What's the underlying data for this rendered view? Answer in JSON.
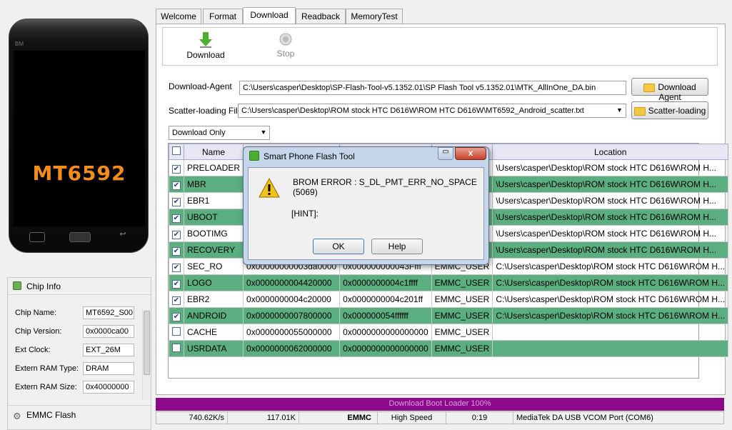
{
  "phone": {
    "brand": "BM",
    "chip": "MT6592"
  },
  "chip_info": {
    "header": "Chip Info",
    "fields": [
      {
        "label": "Chip Name:",
        "value": "MT6592_S00"
      },
      {
        "label": "Chip Version:",
        "value": "0x0000ca00"
      },
      {
        "label": "Ext Clock:",
        "value": "EXT_26M"
      },
      {
        "label": "Extern RAM Type:",
        "value": "DRAM"
      },
      {
        "label": "Extern RAM Size:",
        "value": "0x40000000"
      }
    ],
    "footer": "EMMC Flash"
  },
  "tabs": [
    "Welcome",
    "Format",
    "Download",
    "Readback",
    "MemoryTest"
  ],
  "toolbar": {
    "download": "Download",
    "stop": "Stop"
  },
  "agent": {
    "label": "Download-Agent",
    "value": "C:\\Users\\casper\\Desktop\\SP-Flash-Tool-v5.1352.01\\SP Flash Tool v5.1352.01\\MTK_AllInOne_DA.bin",
    "button": "Download Agent"
  },
  "scatter": {
    "label": "Scatter-loading File",
    "value": "C:\\Users\\casper\\Desktop\\ROM stock HTC D616W\\ROM HTC D616W\\MT6592_Android_scatter.txt",
    "button": "Scatter-loading"
  },
  "mode": "Download Only",
  "table": {
    "headers": [
      "Name",
      "Location"
    ],
    "rows": [
      {
        "name": "PRELOADER",
        "begin": "",
        "end": "",
        "region": "",
        "location": "\\Users\\casper\\Desktop\\ROM stock HTC D616W\\ROM H...",
        "checked": true
      },
      {
        "name": "MBR",
        "begin": "",
        "end": "",
        "region": "",
        "location": "\\Users\\casper\\Desktop\\ROM stock HTC D616W\\ROM H...",
        "checked": true
      },
      {
        "name": "EBR1",
        "begin": "",
        "end": "",
        "region": "",
        "location": "\\Users\\casper\\Desktop\\ROM stock HTC D616W\\ROM H...",
        "checked": true
      },
      {
        "name": "UBOOT",
        "begin": "",
        "end": "",
        "region": "",
        "location": "\\Users\\casper\\Desktop\\ROM stock HTC D616W\\ROM H...",
        "checked": true
      },
      {
        "name": "BOOTIMG",
        "begin": "",
        "end": "",
        "region": "",
        "location": "\\Users\\casper\\Desktop\\ROM stock HTC D616W\\ROM H...",
        "checked": true
      },
      {
        "name": "RECOVERY",
        "begin": "",
        "end": "",
        "region": "",
        "location": "\\Users\\casper\\Desktop\\ROM stock HTC D616W\\ROM H...",
        "checked": true
      },
      {
        "name": "SEC_RO",
        "begin": "0x00000000003da0000",
        "end": "0x000000000043Ffff",
        "region": "EMMC_USER",
        "location": "C:\\Users\\casper\\Desktop\\ROM stock HTC D616W\\ROM H...",
        "checked": true
      },
      {
        "name": "LOGO",
        "begin": "0x0000000004420000",
        "end": "0x0000000004c1ffff",
        "region": "EMMC_USER",
        "location": "C:\\Users\\casper\\Desktop\\ROM stock HTC D616W\\ROM H...",
        "checked": true
      },
      {
        "name": "EBR2",
        "begin": "0x0000000004c20000",
        "end": "0x0000000004c201ff",
        "region": "EMMC_USER",
        "location": "C:\\Users\\casper\\Desktop\\ROM stock HTC D616W\\ROM H...",
        "checked": true
      },
      {
        "name": "ANDROID",
        "begin": "0x0000000007800000",
        "end": "0x000000054ffffff",
        "region": "EMMC_USER",
        "location": "C:\\Users\\casper\\Desktop\\ROM stock HTC D616W\\ROM H...",
        "checked": true
      },
      {
        "name": "CACHE",
        "begin": "0x0000000055000000",
        "end": "0x0000000000000000",
        "region": "EMMC_USER",
        "location": "",
        "checked": false
      },
      {
        "name": "USRDATA",
        "begin": "0x0000000062000000",
        "end": "0x0000000000000000",
        "region": "EMMC_USER",
        "location": "",
        "checked": false
      }
    ]
  },
  "progress": {
    "text": "Download Boot Loader 100%",
    "fraction": 1.0
  },
  "status": {
    "speed": "740.62K/s",
    "size": "117.01K",
    "storage": "EMMC",
    "mode": "High Speed",
    "time": "0:19",
    "port": "MediaTek DA USB VCOM Port (COM6)"
  },
  "dialog": {
    "title": "Smart Phone Flash Tool",
    "message": "BROM ERROR : S_DL_PMT_ERR_NO_SPACE (5069)",
    "hint": "[HINT]:",
    "ok": "OK",
    "help": "Help",
    "close": "x"
  },
  "colors": {
    "row_green": "#5aae7f",
    "progress": "#8b0a8b",
    "chip": "#f28d1c"
  }
}
